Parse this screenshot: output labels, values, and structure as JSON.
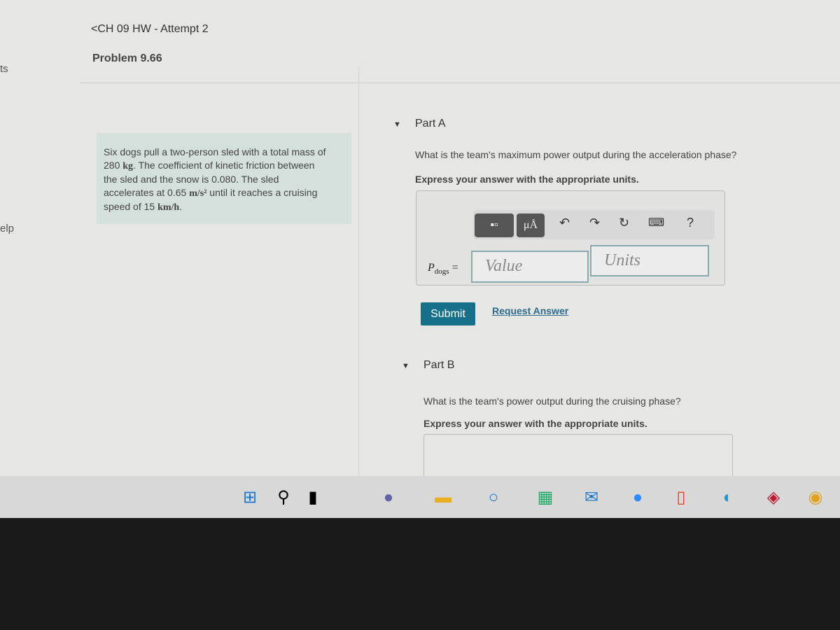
{
  "header": {
    "breadcrumb": "<CH 09 HW - Attempt 2",
    "problem_title": "Problem 9.66"
  },
  "sidebar": {
    "item_1": "ts",
    "item_2": "elp"
  },
  "problem": {
    "l1": "Six dogs pull a two-person sled with a total mass of",
    "l2a": "280 ",
    "l2u": "kg",
    "l2b": ". The coefficient of kinetic friction between",
    "l3": "the sled and the snow is 0.080. The sled",
    "l4a": "accelerates at 0.65 ",
    "l4u": "m/s²",
    "l4b": " until it reaches a cruising",
    "l5a": "speed of 15 ",
    "l5u": "km/h",
    "l5b": "."
  },
  "partA": {
    "label": "Part A",
    "question": "What is the team's maximum power output during the acceleration phase?",
    "instruction": "Express your answer with the appropriate units.",
    "toolbar": {
      "units_btn": "μÅ",
      "help": "?"
    },
    "var": "P",
    "var_sub": "dogs",
    "eq": "=",
    "value_placeholder": "Value",
    "units_placeholder": "Units",
    "submit": "Submit",
    "request": "Request Answer"
  },
  "partB": {
    "label": "Part B",
    "question": "What is the team's power output during the cruising phase?",
    "instruction": "Express your answer with the appropriate units."
  },
  "taskbar": {
    "icons": [
      "windows-start",
      "search",
      "task-view",
      "teams-chat",
      "file-explorer",
      "cortana",
      "microsoft-store",
      "mail",
      "zoom",
      "office",
      "edge",
      "mcafee",
      "chrome"
    ]
  },
  "colors": {
    "submit": "#16708a",
    "problem_bg": "#d4e0dc",
    "link": "#2c6b8e"
  }
}
